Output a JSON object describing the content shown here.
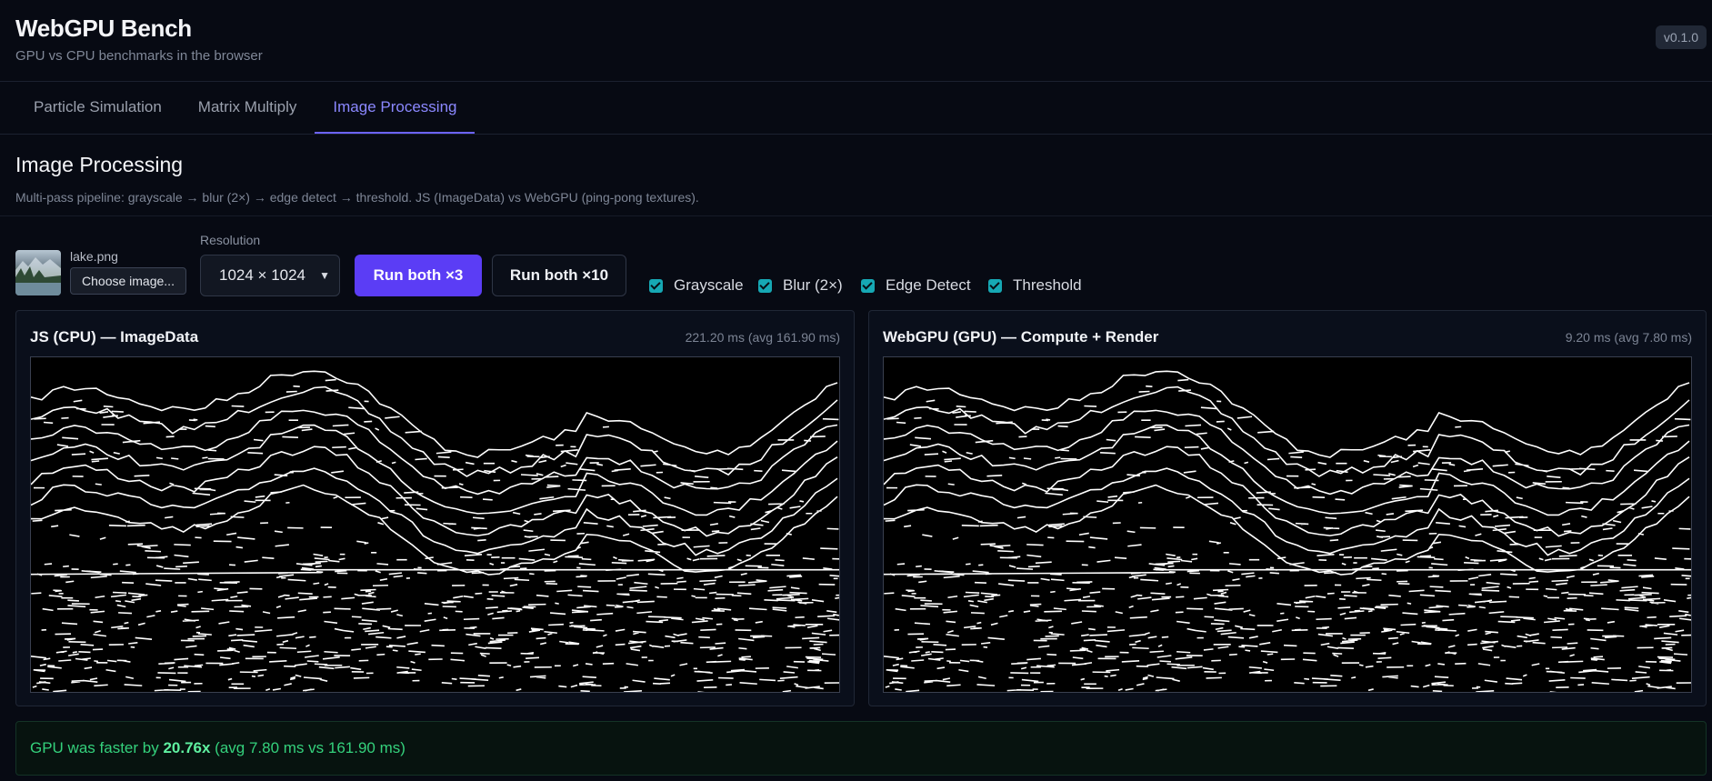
{
  "app": {
    "title": "WebGPU Bench",
    "subtitle": "GPU vs CPU benchmarks in the browser",
    "version": "v0.1.0"
  },
  "tabs": [
    {
      "label": "Particle Simulation",
      "active": false
    },
    {
      "label": "Matrix Multiply",
      "active": false
    },
    {
      "label": "Image Processing",
      "active": true
    }
  ],
  "section": {
    "title": "Image Processing",
    "description": "Multi-pass pipeline: grayscale → blur (2×) → edge detect → threshold. JS (ImageData) vs WebGPU (ping-pong textures)."
  },
  "controls": {
    "file_name": "lake.png",
    "choose_label": "Choose image...",
    "resolution_label": "Resolution",
    "resolution_value": "1024 × 1024",
    "run3_label": "Run both ×3",
    "run10_label": "Run both ×10",
    "checkboxes": [
      {
        "label": "Grayscale",
        "checked": true
      },
      {
        "label": "Blur (2×)",
        "checked": true
      },
      {
        "label": "Edge Detect",
        "checked": true
      },
      {
        "label": "Threshold",
        "checked": true
      }
    ]
  },
  "panels": {
    "cpu": {
      "title": "JS (CPU) — ImageData",
      "timing": "221.20 ms (avg 161.90 ms)"
    },
    "gpu": {
      "title": "WebGPU (GPU) — Compute + Render",
      "timing": "9.20 ms (avg 7.80 ms)"
    }
  },
  "result": {
    "prefix": "GPU was faster by ",
    "factor": "20.76x",
    "suffix": " (avg 7.80 ms vs 161.90 ms)"
  },
  "colors": {
    "accent": "#6c63ff",
    "primary_button": "#5b3df5",
    "checkbox": "#16a8b4",
    "success": "#34d17c"
  }
}
